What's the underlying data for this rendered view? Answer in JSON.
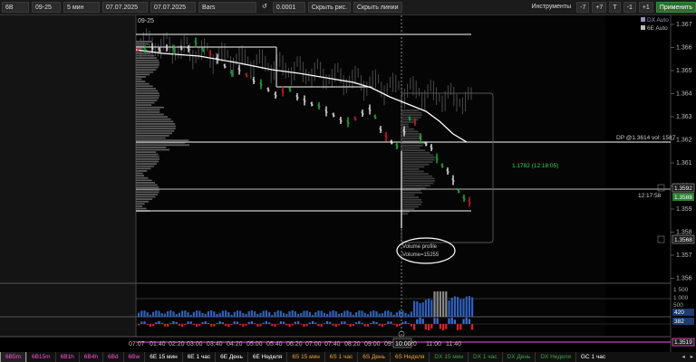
{
  "toolbar": {
    "symbol": "6B",
    "contract": "09-25",
    "interval": "5 мин",
    "date_from": "07.07.2025",
    "date_to": "07.07.2025",
    "chart_type": "Bars",
    "tick": "0.0001",
    "hide_drawings": "Скрыть рис.",
    "hide_lines": "Скрыть линии",
    "instruments": "Инструменты",
    "minus7": "-7",
    "plus7": "+7",
    "t": "T",
    "minus1": "-1",
    "plus1": "+1",
    "apply": "Применить"
  },
  "chart": {
    "contract_label": "09-25",
    "legend": [
      {
        "label": "DX Auto",
        "color": "#9b8fbf"
      },
      {
        "label": "6E Auto",
        "color": "#c8c8c8"
      }
    ],
    "price_labels": [
      "1.367",
      "1.366",
      "1.365",
      "1.364",
      "1.363",
      "1.362",
      "1.361",
      "1.36",
      "1.359",
      "1.358",
      "1.357",
      "1.356"
    ],
    "price_levels": [
      1.367,
      1.366,
      1.365,
      1.364,
      1.363,
      1.362,
      1.361,
      1.36,
      1.359,
      1.358,
      1.357,
      1.356
    ],
    "dp_label": "DP @1.3614 vol: 1587",
    "cursor_box_label": "1.1782 (12:18:05)",
    "time_flag": "12:17:58",
    "price_tag_1": "1.3592",
    "price_tag_current": "1.3588",
    "price_tag_2": "1.3568",
    "profile_title": "Volume profile",
    "profile_volume": "Volume=15255",
    "volume_axis": [
      "1 500",
      "1 000",
      "500"
    ],
    "volume_tag": "420",
    "delta_tag": "382",
    "bottom_tag": "1.3519",
    "time_axis": [
      "07.07",
      "01:40",
      "02:20",
      "03:00",
      "03:40",
      "04:20",
      "05:00",
      "05:40",
      "06:20",
      "07:00",
      "07:40",
      "08:20",
      "09:00",
      "09:40",
      "10:00",
      "20",
      "11:00",
      "11:40"
    ],
    "crosshair_time": "10:00",
    "colors": {
      "up": "#1fbf3f",
      "down": "#e0202a",
      "level": "#c8c8c8",
      "secondary": "#9a9a9a",
      "tag_green": "#2e7d32",
      "tag_dark": "#1a1a1a"
    }
  },
  "tabs": [
    {
      "label": "6B5m",
      "color": "#ff4fd8",
      "active": true
    },
    {
      "label": "6B15m",
      "color": "#ff4fd8"
    },
    {
      "label": "6B1h",
      "color": "#ff4fd8"
    },
    {
      "label": "6B4h",
      "color": "#ff4fd8"
    },
    {
      "label": "6Bd",
      "color": "#ff4fd8"
    },
    {
      "label": "6Bw",
      "color": "#ff4fd8"
    },
    {
      "label": "6E 15 мин",
      "color": "#ffffff"
    },
    {
      "label": "6E 1 час",
      "color": "#ffffff"
    },
    {
      "label": "6E День",
      "color": "#ffffff"
    },
    {
      "label": "6E Неделя",
      "color": "#ffffff"
    },
    {
      "label": "6S 15 мин",
      "color": "#f0a030"
    },
    {
      "label": "6S 1 час",
      "color": "#f0a030"
    },
    {
      "label": "6S День",
      "color": "#f0a030"
    },
    {
      "label": "6S Неделя",
      "color": "#f0a030"
    },
    {
      "label": "DX 15 мин",
      "color": "#3fa04f"
    },
    {
      "label": "DX 1 час",
      "color": "#3fa04f"
    },
    {
      "label": "DX День",
      "color": "#3fa04f"
    },
    {
      "label": "DX Неделя",
      "color": "#3fa04f"
    },
    {
      "label": "GC 1 час",
      "color": "#ffffff"
    }
  ]
}
